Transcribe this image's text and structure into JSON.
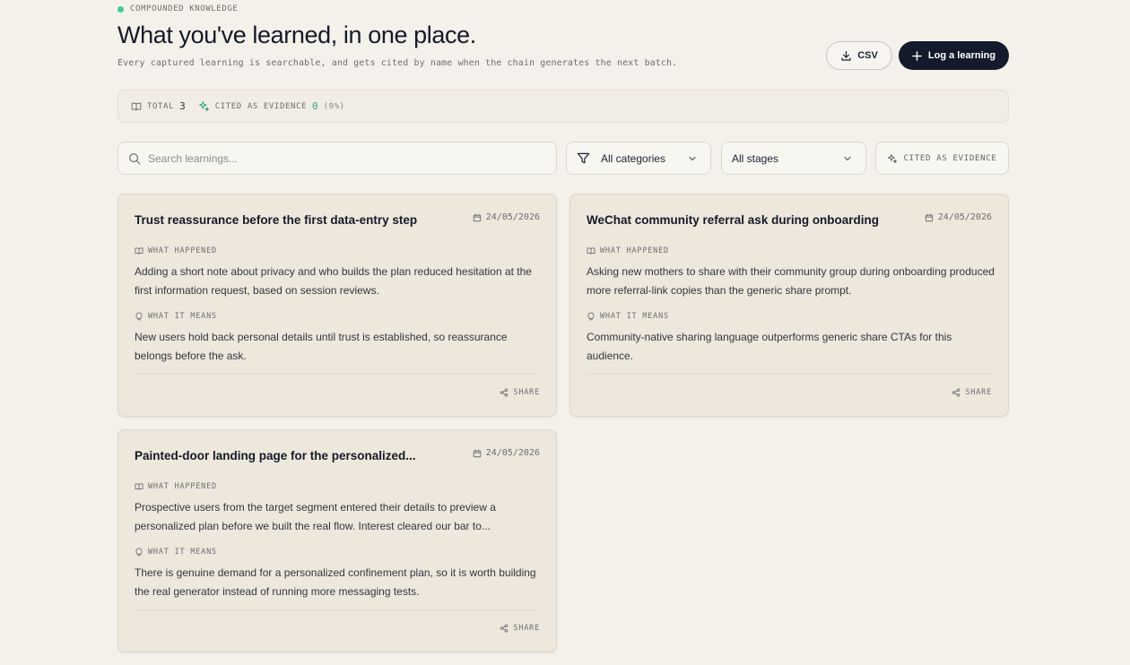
{
  "header": {
    "eyebrow": "COMPOUNDED KNOWLEDGE",
    "title": "What you've learned, in one place.",
    "subtitle": "Every captured learning is searchable, and gets cited by name when the chain generates the next batch.",
    "csv_label": "CSV",
    "log_label": "Log a learning"
  },
  "stats": {
    "total_label": "TOTAL",
    "total_value": "3",
    "cited_label": "CITED AS EVIDENCE",
    "cited_value": "0",
    "cited_pct": "(0%)"
  },
  "filters": {
    "search_placeholder": "Search learnings...",
    "category": "All categories",
    "stage": "All stages",
    "cited_toggle": "CITED AS EVIDENCE"
  },
  "labels": {
    "what_happened": "WHAT HAPPENED",
    "what_it_means": "WHAT IT MEANS",
    "share": "SHARE"
  },
  "cards": [
    {
      "title": "Trust reassurance before the first data-entry step",
      "date": "24/05/2026",
      "what_happened": "Adding a short note about privacy and who builds the plan reduced hesitation at the first information request, based on session reviews.",
      "what_it_means": "New users hold back personal details until trust is established, so reassurance belongs before the ask."
    },
    {
      "title": "WeChat community referral ask during onboarding",
      "date": "24/05/2026",
      "what_happened": "Asking new mothers to share with their community group during onboarding produced more referral-link copies than the generic share prompt.",
      "what_it_means": "Community-native sharing language outperforms generic share CTAs for this audience."
    },
    {
      "title": "Painted-door landing page for the personalized...",
      "date": "24/05/2026",
      "what_happened": "Prospective users from the target segment entered their details to preview a personalized plan before we built the real flow. Interest cleared our bar to...",
      "what_it_means": "There is genuine demand for a personalized confinement plan, so it is worth building the real generator instead of running more messaging tests."
    }
  ],
  "colors": {
    "background": "#f4f1ea",
    "card": "#ede7dc",
    "primary_button": "#121a2b",
    "accent_green": "#3ecf8e"
  }
}
